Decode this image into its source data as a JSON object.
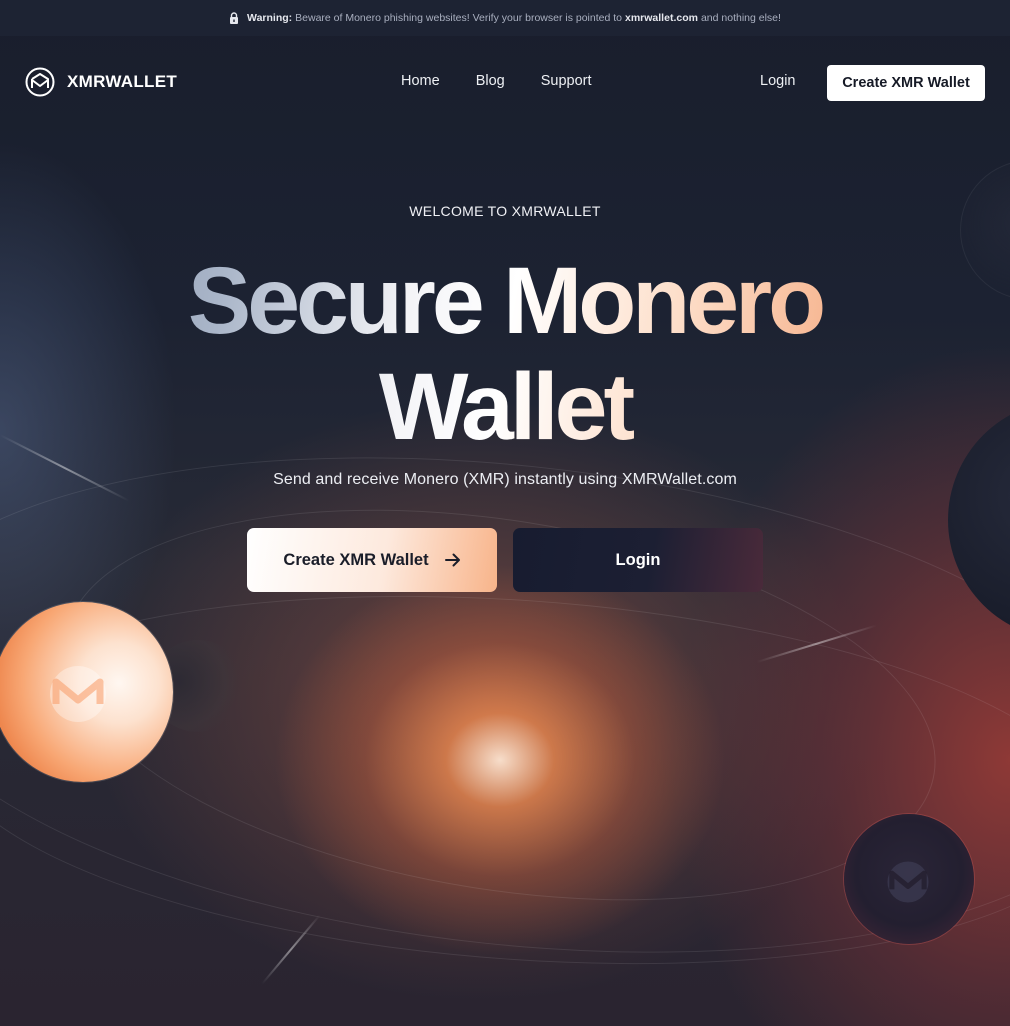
{
  "warning": {
    "label": "Warning:",
    "text_before": "Beware of Monero phishing websites! Verify your browser is pointed to",
    "domain": "xmrwallet.com",
    "text_after": "and nothing else!"
  },
  "header": {
    "logo_text": "XMRWALLET",
    "nav": [
      "Home",
      "Blog",
      "Support"
    ],
    "login_label": "Login",
    "create_label": "Create XMR Wallet"
  },
  "hero": {
    "eyebrow": "WELCOME TO XMRWALLET",
    "title_line1": "Secure Monero",
    "title_line2": "Wallet",
    "subtitle": "Send and receive Monero (XMR) instantly using XMRWallet.com",
    "create_button": "Create XMR Wallet",
    "login_button": "Login"
  },
  "icons": {
    "lock": "lock-icon",
    "logo": "monero-logo-icon",
    "arrow": "arrow-right-icon"
  },
  "colors": {
    "background": "#1b2030",
    "accent_orange": "#f6a67c",
    "button_dark": "#171c30"
  }
}
